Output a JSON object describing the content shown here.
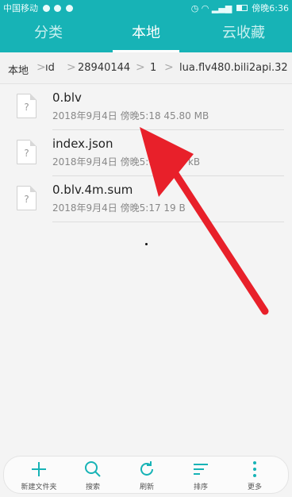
{
  "status_bar": {
    "carrier": "中国移动",
    "time": "傍晚6:36"
  },
  "tabs": [
    {
      "label": "分类",
      "active": false
    },
    {
      "label": "本地",
      "active": true
    },
    {
      "label": "云收藏",
      "active": false
    }
  ],
  "breadcrumb": [
    "本地",
    "ıd",
    "28940144",
    "1",
    "lua.flv480.bili2api.32"
  ],
  "files": [
    {
      "name": "0.blv",
      "date": "2018年9月4日",
      "time": "傍晚5:18",
      "size": "45.80 MB",
      "icon": "unknown-file-icon",
      "icon_glyph": "?"
    },
    {
      "name": "index.json",
      "date": "2018年9月4日",
      "time": "傍晚5:18",
      "size": "1.85 kB",
      "icon": "unknown-file-icon",
      "icon_glyph": "?"
    },
    {
      "name": "0.blv.4m.sum",
      "date": "2018年9月4日",
      "time": "傍晚5:17",
      "size": "19 B",
      "icon": "unknown-file-icon",
      "icon_glyph": "?"
    }
  ],
  "toolbar": {
    "new_folder": "新建文件夹",
    "search": "搜索",
    "refresh": "刷新",
    "sort": "排序",
    "more": "更多"
  },
  "colors": {
    "accent": "#17b3b6",
    "annotation_arrow": "#e8202a"
  }
}
